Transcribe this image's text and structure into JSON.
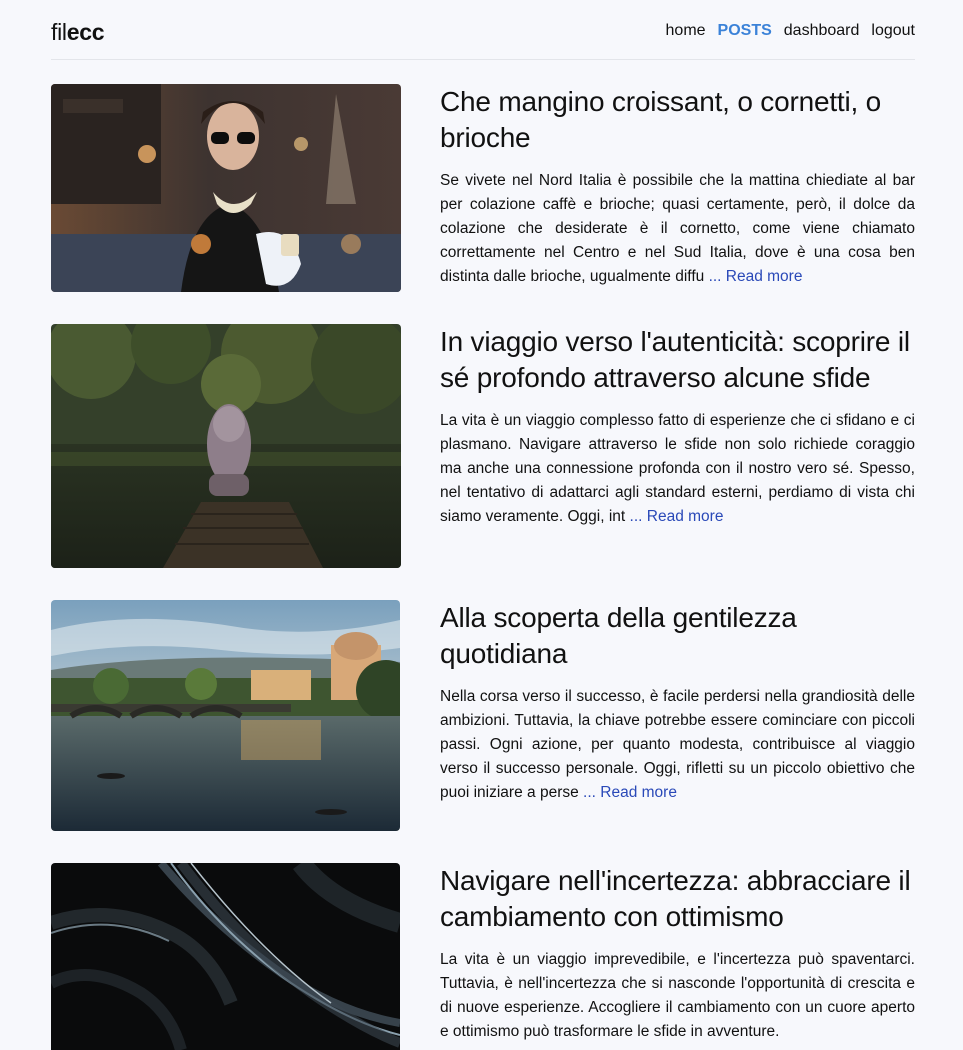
{
  "header": {
    "logo_light": "fil",
    "logo_bold": "ecc",
    "nav": [
      {
        "label": "home"
      },
      {
        "label": "POSTS"
      },
      {
        "label": "dashboard"
      },
      {
        "label": "logout"
      }
    ]
  },
  "posts": [
    {
      "title": "Che mangino croissant, o cornetti, o brioche",
      "excerpt": "Se vivete nel Nord Italia è possibile che la mattina chiediate al bar per colazione caffè e brioche; quasi certamente, però, il dolce da colazione che desiderate è il cornetto, come viene chiamato correttamente nel Centro e nel Sud Italia, dove è una cosa ben distinta dalle brioche, ugualmente diffu",
      "read_more": "... Read more"
    },
    {
      "title": "In viaggio verso l'autenticità: scoprire il sé profondo attraverso alcune sfide",
      "excerpt": "La vita è un viaggio complesso fatto di esperienze che ci sfidano e ci plasmano. Navigare attraverso le sfide non solo richiede coraggio ma anche una connessione profonda con il nostro vero sé. Spesso, nel tentativo di adattarci agli standard esterni, perdiamo di vista chi siamo veramente. Oggi, int",
      "read_more": "... Read more"
    },
    {
      "title": "Alla scoperta della gentilezza quotidiana",
      "excerpt": "Nella corsa verso il successo, è facile perdersi nella grandiosità delle ambizioni. Tuttavia, la chiave potrebbe essere cominciare con piccoli passi. Ogni azione, per quanto modesta, contribuisce al viaggio verso il successo personale. Oggi, rifletti su un piccolo obiettivo che puoi iniziare a perse",
      "read_more": "... Read more"
    },
    {
      "title": "Navigare nell'incertezza: abbracciare il cambiamento con ottimismo",
      "excerpt": "La vita è un viaggio imprevedibile, e l'incertezza può spaventarci. Tuttavia, è nell'incertezza che si nasconde l'opportunità di crescita e di nuove esperienze. Accogliere il cambiamento con un cuore aperto e ottimismo può trasformare le sfide in avventure.",
      "read_more": ""
    }
  ]
}
